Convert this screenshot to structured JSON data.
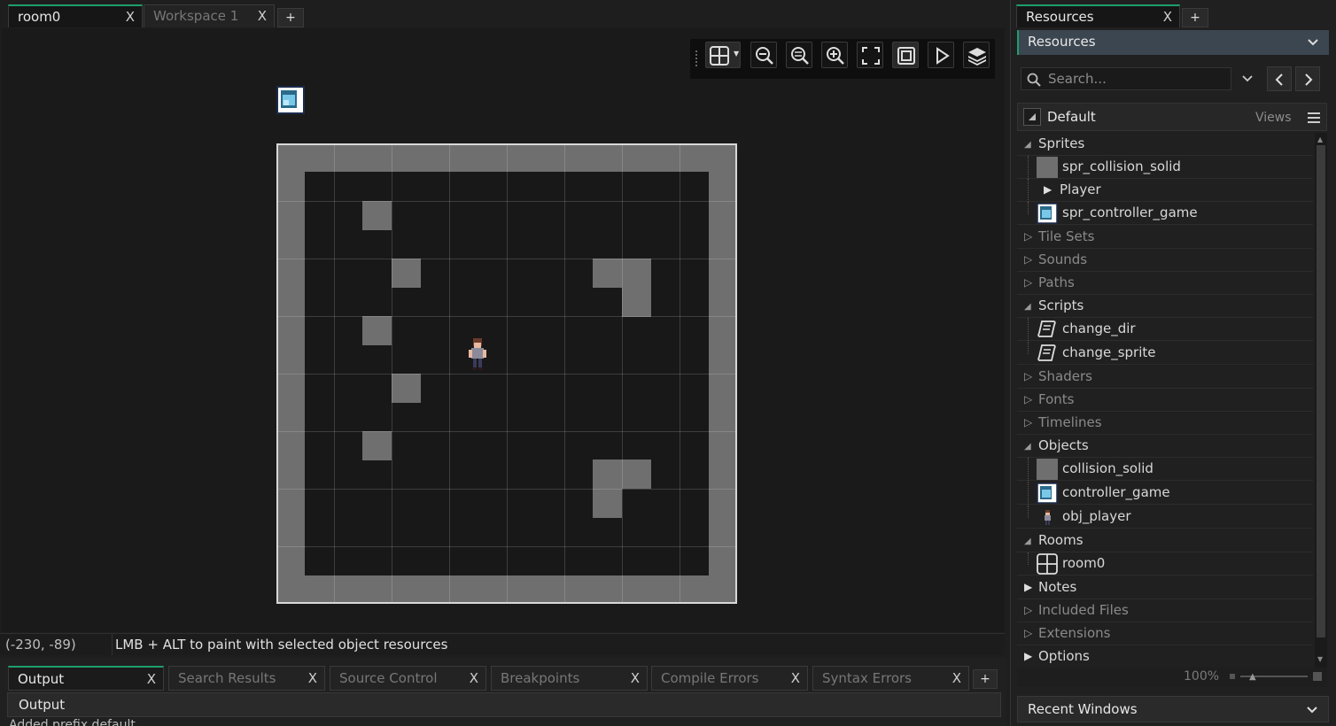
{
  "editor_tabs": [
    {
      "label": "room0",
      "close": "X"
    },
    {
      "label": "Workspace 1",
      "close": "X"
    }
  ],
  "add_tab": "+",
  "toolbar": {
    "icons": [
      "grid-icon",
      "zoom-out-icon",
      "zoom-reset-icon",
      "zoom-in-icon",
      "fullscreen-icon",
      "fit-room-icon",
      "play-icon",
      "layers-icon"
    ]
  },
  "status": {
    "coords": "(-230, -89)",
    "hint": "LMB + ALT to paint with selected object resources"
  },
  "bottom_tabs": [
    {
      "label": "Output",
      "close": "X"
    },
    {
      "label": "Search Results",
      "close": "X"
    },
    {
      "label": "Source Control",
      "close": "X"
    },
    {
      "label": "Breakpoints",
      "close": "X"
    },
    {
      "label": "Compile Errors",
      "close": "X"
    },
    {
      "label": "Syntax Errors",
      "close": "X"
    }
  ],
  "output": {
    "header": "Output",
    "line": "Added prefix default"
  },
  "resources": {
    "tab_label": "Resources",
    "tab_close": "X",
    "add": "+",
    "dropdown_label": "Resources",
    "search_placeholder": "Search...",
    "view_name": "Default",
    "views_label": "Views",
    "groups": {
      "sprites": "Sprites",
      "tilesets": "Tile Sets",
      "sounds": "Sounds",
      "paths": "Paths",
      "scripts": "Scripts",
      "shaders": "Shaders",
      "fonts": "Fonts",
      "timelines": "Timelines",
      "objects": "Objects",
      "rooms": "Rooms",
      "notes": "Notes",
      "included": "Included Files",
      "extensions": "Extensions",
      "options": "Options"
    },
    "items": {
      "spr_collision_solid": "spr_collision_solid",
      "player_folder": "Player",
      "spr_controller_game": "spr_controller_game",
      "change_dir": "change_dir",
      "change_sprite": "change_sprite",
      "collision_solid": "collision_solid",
      "controller_game": "controller_game",
      "obj_player": "obj_player",
      "room0": "room0"
    },
    "zoom": "100%",
    "zoom_level": 0.3,
    "recent": "Recent Windows"
  },
  "colors": {
    "accent": "#1f9e6c",
    "wall": "#6f6f6f",
    "panel": "#202020"
  }
}
